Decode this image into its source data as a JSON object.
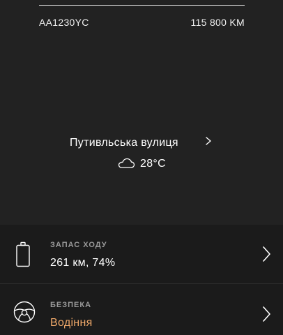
{
  "vehicle": {
    "plate": "AA1230YC",
    "mileage": "115 800 KM"
  },
  "location": {
    "street": "Путивльська вулиця",
    "chevron_icon": "chevron-right-icon"
  },
  "weather": {
    "icon": "cloud-icon",
    "temperature": "28°C"
  },
  "cards": {
    "range": {
      "icon": "battery-icon",
      "label": "ЗАПАС ХОДУ",
      "value": "261 км, 74%",
      "value_color": "#ffffff",
      "chevron_icon": "chevron-right-icon"
    },
    "security": {
      "icon": "steering-wheel-icon",
      "label": "БЕЗПЕКА",
      "value": "Водіння",
      "value_color": "#f0a96a",
      "chevron_icon": "chevron-right-icon"
    }
  }
}
